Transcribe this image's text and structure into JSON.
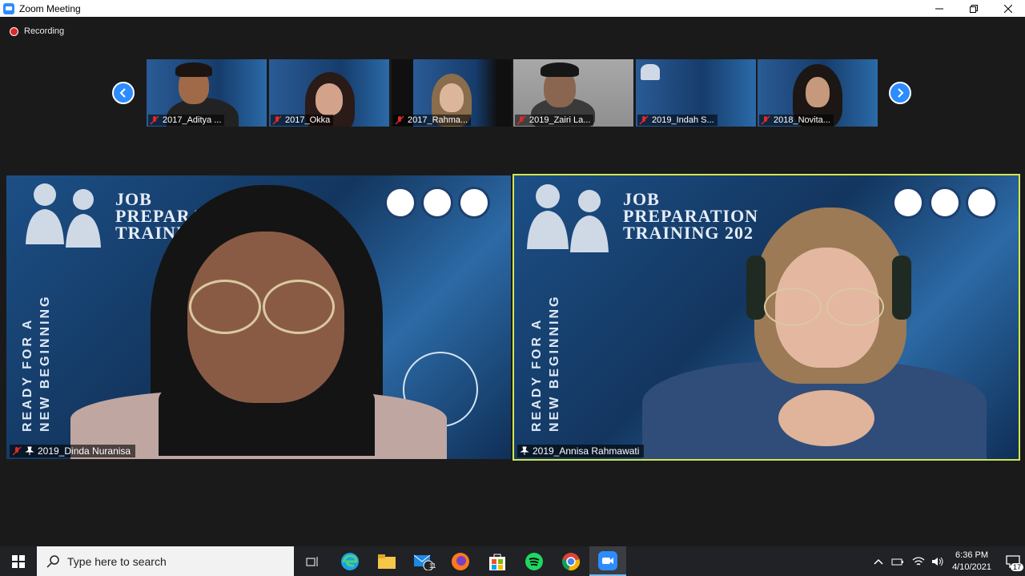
{
  "window": {
    "title": "Zoom Meeting",
    "minimize": "—",
    "restore": "❐",
    "close": "✕"
  },
  "recording": {
    "label": "Recording"
  },
  "thumbnails": [
    {
      "name": "2017_Aditya ...",
      "muted": true
    },
    {
      "name": "2017_Okka",
      "muted": true
    },
    {
      "name": "2017_Rahma...",
      "muted": true
    },
    {
      "name": "2019_Zairi La...",
      "muted": true
    },
    {
      "name": "2019_Indah S...",
      "muted": true
    },
    {
      "name": "2018_Novita...",
      "muted": true
    }
  ],
  "main_videos": [
    {
      "name": "2019_Dinda Nuranisa",
      "muted": true,
      "pinned": true,
      "title_lines": [
        "JOB",
        "PREPARAT",
        "TRAINING"
      ],
      "vertical_lines": [
        "READY FOR A",
        "NEW BEGINNING"
      ]
    },
    {
      "name": "2019_Annisa Rahmawati",
      "muted": false,
      "pinned": true,
      "active_speaker": true,
      "title_lines": [
        "JOB",
        "PREPARATION",
        "TRAINING 202"
      ],
      "vertical_lines": [
        "READY FOR A",
        "NEW BEGINNING"
      ]
    }
  ],
  "taskbar": {
    "search_placeholder": "Type here to search",
    "apps": [
      "task-view",
      "edge",
      "file-explorer",
      "mail",
      "firefox",
      "store",
      "spotify",
      "chrome",
      "zoom"
    ],
    "mail_badge": "11",
    "time": "6:36 PM",
    "date": "4/10/2021",
    "notifications": "17"
  },
  "colors": {
    "accent": "#2D8CFF",
    "active_border": "#d4e64e",
    "muted_red": "#e02828"
  }
}
